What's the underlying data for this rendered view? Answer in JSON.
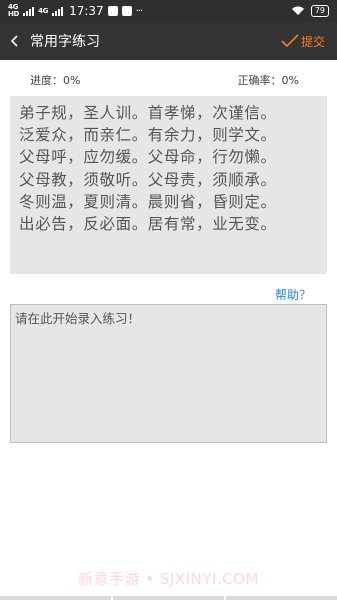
{
  "status_bar": {
    "signal_label_top": "4G",
    "signal_label_bottom": "HD",
    "signal2_label": "4G",
    "time": "17:37",
    "more": "···",
    "battery": "79"
  },
  "header": {
    "back_icon": "chevron-left-icon",
    "title": "常用字练习",
    "submit_label": "提交",
    "accent_color": "#ff7a1a"
  },
  "stats": {
    "progress": "进度：0%",
    "accuracy": "正确率：0%"
  },
  "passage": {
    "lines": [
      "弟子规，圣人训。首孝悌，次谨信。",
      "泛爱众，而亲仁。有余力，则学文。",
      "父母呼，应勿缓。父母命，行勿懒。",
      "父母教，须敬听。父母责，须顺承。",
      "冬则温，夏则清。晨则省，昏则定。",
      "出必告，反必面。居有常，业无变。"
    ]
  },
  "help_link": "帮助？",
  "input": {
    "placeholder": "请在此开始录入练习！",
    "value": ""
  },
  "watermark": "新意手游 • SJXINYI.COM"
}
